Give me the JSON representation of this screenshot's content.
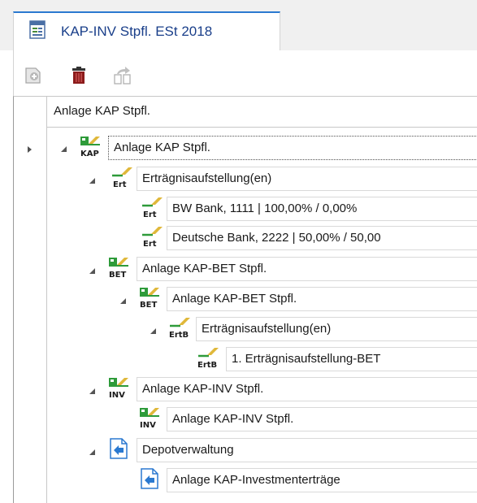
{
  "tab": {
    "title": "KAP-INV Stpfl. ESt 2018",
    "icon": "form-document-icon"
  },
  "toolbar": {
    "buttons": [
      {
        "name": "add-button",
        "icon": "document-add-icon"
      },
      {
        "name": "delete-button",
        "icon": "trash-icon"
      },
      {
        "name": "move-button",
        "icon": "move-arrow-icon"
      }
    ]
  },
  "grid": {
    "column_header": "Anlage KAP Stpfl.",
    "nodes": [
      {
        "label": "Anlage KAP Stpfl.",
        "icon_code": "KAP"
      },
      {
        "label": "Erträgnisaufstellung(en)",
        "icon_code": "Ert"
      },
      {
        "label": "BW Bank, 1111 | 100,00% / 0,00%",
        "icon_code": "Ert"
      },
      {
        "label": "Deutsche Bank, 2222 | 50,00% / 50,00",
        "icon_code": "Ert"
      },
      {
        "label": "Anlage KAP-BET Stpfl.",
        "icon_code": "BET"
      },
      {
        "label": "Anlage KAP-BET Stpfl.",
        "icon_code": "BET"
      },
      {
        "label": "Erträgnisaufstellung(en)",
        "icon_code": "ErtB"
      },
      {
        "label": "1. Erträgnisaufstellung-BET",
        "icon_code": "ErtB"
      },
      {
        "label": "Anlage KAP-INV Stpfl.",
        "icon_code": "INV"
      },
      {
        "label": "Anlage KAP-INV Stpfl.",
        "icon_code": "INV"
      },
      {
        "label": "Depotverwaltung",
        "icon_code": ""
      },
      {
        "label": "Anlage KAP-Investmenterträge",
        "icon_code": ""
      }
    ]
  },
  "colors": {
    "accent": "#2b79d0",
    "tab_title": "#1a3f8a",
    "icon_green": "#2e9b3a",
    "icon_yellow": "#e0b83a",
    "trash_red": "#8b1b1b"
  }
}
